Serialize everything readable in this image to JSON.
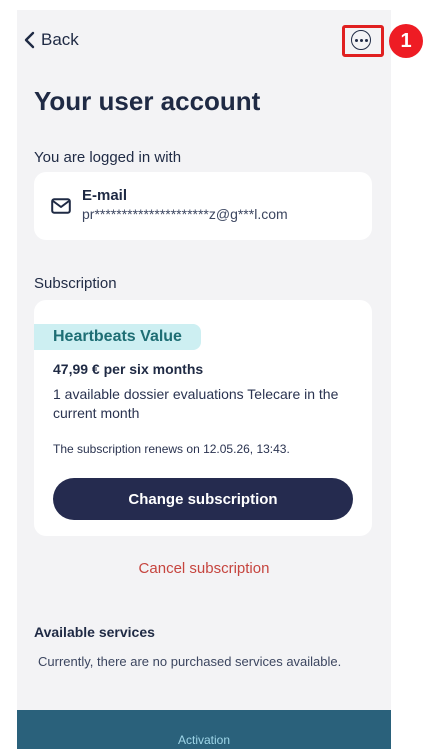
{
  "header": {
    "back_label": "Back",
    "more_icon": "more-options-icon"
  },
  "page": {
    "title": "Your user account"
  },
  "login": {
    "section_label": "You are logged in with",
    "method_label": "E-mail",
    "email_masked": "pr*********************z@g***l.com",
    "icon": "mail-icon"
  },
  "subscription": {
    "section_label": "Subscription",
    "plan_name": "Heartbeats Value",
    "price": "47,99 € per six months",
    "evaluations": "1 available dossier evaluations Telecare in the current month",
    "renewal": "The subscription renews on 12.05.26, 13:43.",
    "change_button": "Change subscription",
    "cancel_link": "Cancel subscription"
  },
  "services": {
    "title": "Available services",
    "empty_text": "Currently, there are no purchased services available."
  },
  "footer": {
    "activation_label": "Activation"
  },
  "annotation": {
    "marker_label": "1"
  },
  "colors": {
    "screen_background": "#f3f3f5",
    "primary_dark": "#252b4f",
    "badge_background": "#cdeff2",
    "badge_text": "#1e6e74",
    "cancel_red": "#c6453f",
    "footer_teal": "#2a617b",
    "annotation_red": "#e02020"
  }
}
